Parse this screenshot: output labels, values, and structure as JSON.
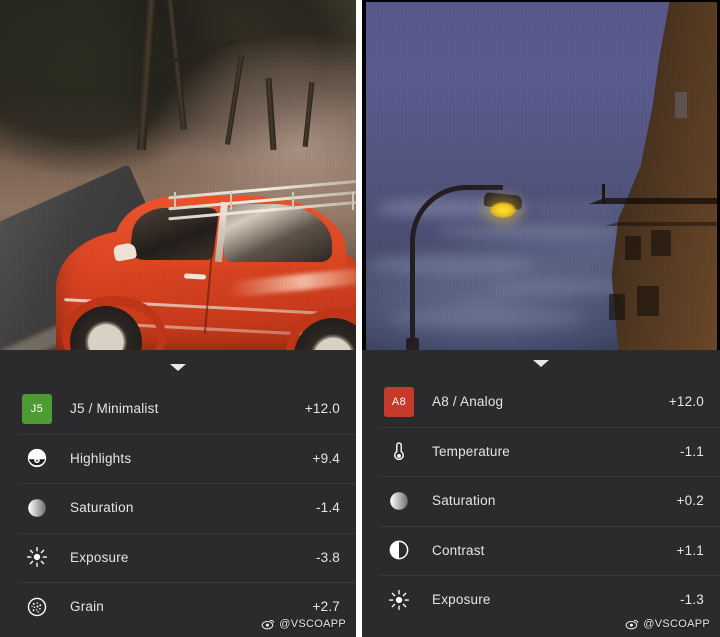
{
  "app": {
    "name": "VSCO",
    "watermark_text": "@VSCOAPP",
    "watermark_icon": "weibo-eye-icon"
  },
  "colors": {
    "panel_bg": "#2b2b2d",
    "divider": "rgba(255,255,255,0.075)",
    "text_primary": "#e4e4e6",
    "badge_green": "#4e9a33",
    "badge_red": "#c53a2b"
  },
  "panels": [
    {
      "id": "left",
      "photo": {
        "name": "orange-vintage-car-photo",
        "alt": "Orange vintage Volkswagen Karmann Ghia with roof rack parked on a dirt road under trees"
      },
      "handle": {
        "name": "collapse-handle",
        "icon": "chevron-down-icon"
      },
      "adjustments": [
        {
          "icon": "preset-badge",
          "badge": "J5",
          "badge_color": "#4e9a33",
          "label": "J5 / Minimalist",
          "value": "+12.0"
        },
        {
          "icon": "highlights-icon",
          "label": "Highlights",
          "value": "+9.4"
        },
        {
          "icon": "saturation-icon",
          "label": "Saturation",
          "value": "-1.4"
        },
        {
          "icon": "exposure-icon",
          "label": "Exposure",
          "value": "-3.8"
        },
        {
          "icon": "grain-icon",
          "label": "Grain",
          "value": "+2.7"
        }
      ]
    },
    {
      "id": "right",
      "photo": {
        "name": "dusk-streetlamp-photo",
        "alt": "Twilight blue sky with a glowing street lamp and a dark building silhouette"
      },
      "handle": {
        "name": "collapse-handle",
        "icon": "chevron-down-icon"
      },
      "adjustments": [
        {
          "icon": "preset-badge",
          "badge": "A8",
          "badge_color": "#c53a2b",
          "label": "A8 / Analog",
          "value": "+12.0"
        },
        {
          "icon": "temperature-icon",
          "label": "Temperature",
          "value": "-1.1"
        },
        {
          "icon": "saturation-icon",
          "label": "Saturation",
          "value": "+0.2"
        },
        {
          "icon": "contrast-icon",
          "label": "Contrast",
          "value": "+1.1"
        },
        {
          "icon": "exposure-icon",
          "label": "Exposure",
          "value": "-1.3"
        }
      ]
    }
  ]
}
